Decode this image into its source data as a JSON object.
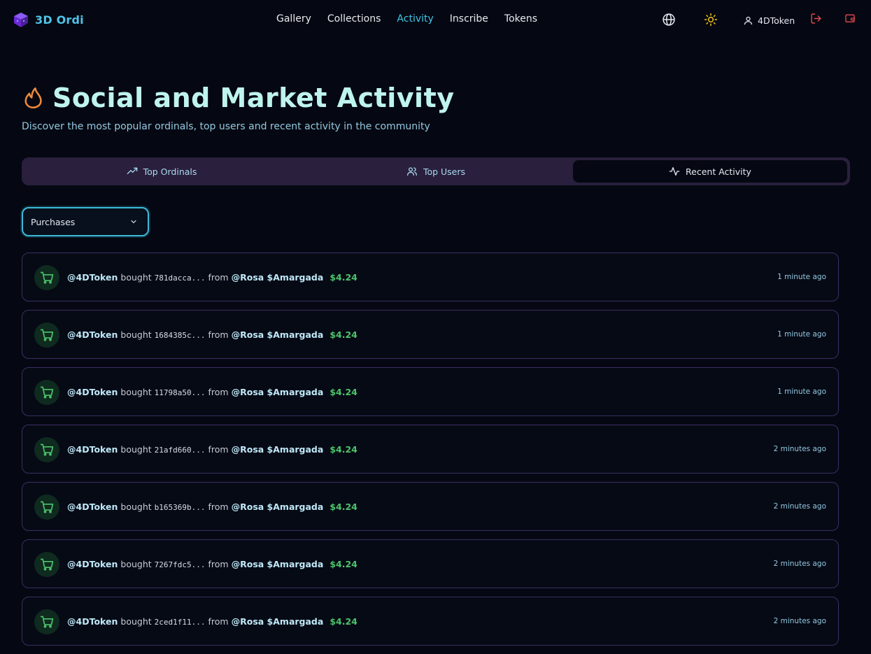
{
  "header": {
    "brand": "3D Ordi",
    "nav": [
      {
        "label": "Gallery",
        "active": false
      },
      {
        "label": "Collections",
        "active": false
      },
      {
        "label": "Activity",
        "active": true
      },
      {
        "label": "Inscribe",
        "active": false
      },
      {
        "label": "Tokens",
        "active": false
      }
    ],
    "user_name": "4DToken",
    "icons": [
      "globe-icon",
      "sun-icon",
      "user-icon",
      "logout-icon",
      "wallet-icon"
    ]
  },
  "page": {
    "title": "Social and Market Activity",
    "subtitle": "Discover the most popular ordinals, top users and recent activity in the community"
  },
  "tabs": [
    {
      "label": "Top Ordinals",
      "icon": "trending-up-icon",
      "active": false
    },
    {
      "label": "Top Users",
      "icon": "users-icon",
      "active": false
    },
    {
      "label": "Recent Activity",
      "icon": "activity-icon",
      "active": true
    }
  ],
  "filter": {
    "selected": "Purchases"
  },
  "activity": [
    {
      "buyer": "@4DToken",
      "verb": "bought",
      "hash": "781dacca...",
      "from": "from",
      "seller": "@Rosa $Amargada",
      "price": "$4.24",
      "time": "1 minute ago"
    },
    {
      "buyer": "@4DToken",
      "verb": "bought",
      "hash": "1684385c...",
      "from": "from",
      "seller": "@Rosa $Amargada",
      "price": "$4.24",
      "time": "1 minute ago"
    },
    {
      "buyer": "@4DToken",
      "verb": "bought",
      "hash": "11798a50...",
      "from": "from",
      "seller": "@Rosa $Amargada",
      "price": "$4.24",
      "time": "1 minute ago"
    },
    {
      "buyer": "@4DToken",
      "verb": "bought",
      "hash": "21afd660...",
      "from": "from",
      "seller": "@Rosa $Amargada",
      "price": "$4.24",
      "time": "2 minutes ago"
    },
    {
      "buyer": "@4DToken",
      "verb": "bought",
      "hash": "b165369b...",
      "from": "from",
      "seller": "@Rosa $Amargada",
      "price": "$4.24",
      "time": "2 minutes ago"
    },
    {
      "buyer": "@4DToken",
      "verb": "bought",
      "hash": "7267fdc5...",
      "from": "from",
      "seller": "@Rosa $Amargada",
      "price": "$4.24",
      "time": "2 minutes ago"
    },
    {
      "buyer": "@4DToken",
      "verb": "bought",
      "hash": "2ced1f11...",
      "from": "from",
      "seller": "@Rosa $Amargada",
      "price": "$4.24",
      "time": "2 minutes ago"
    }
  ],
  "colors": {
    "accent": "#3fc6e6",
    "price": "#4cc46a",
    "background": "#050812"
  }
}
